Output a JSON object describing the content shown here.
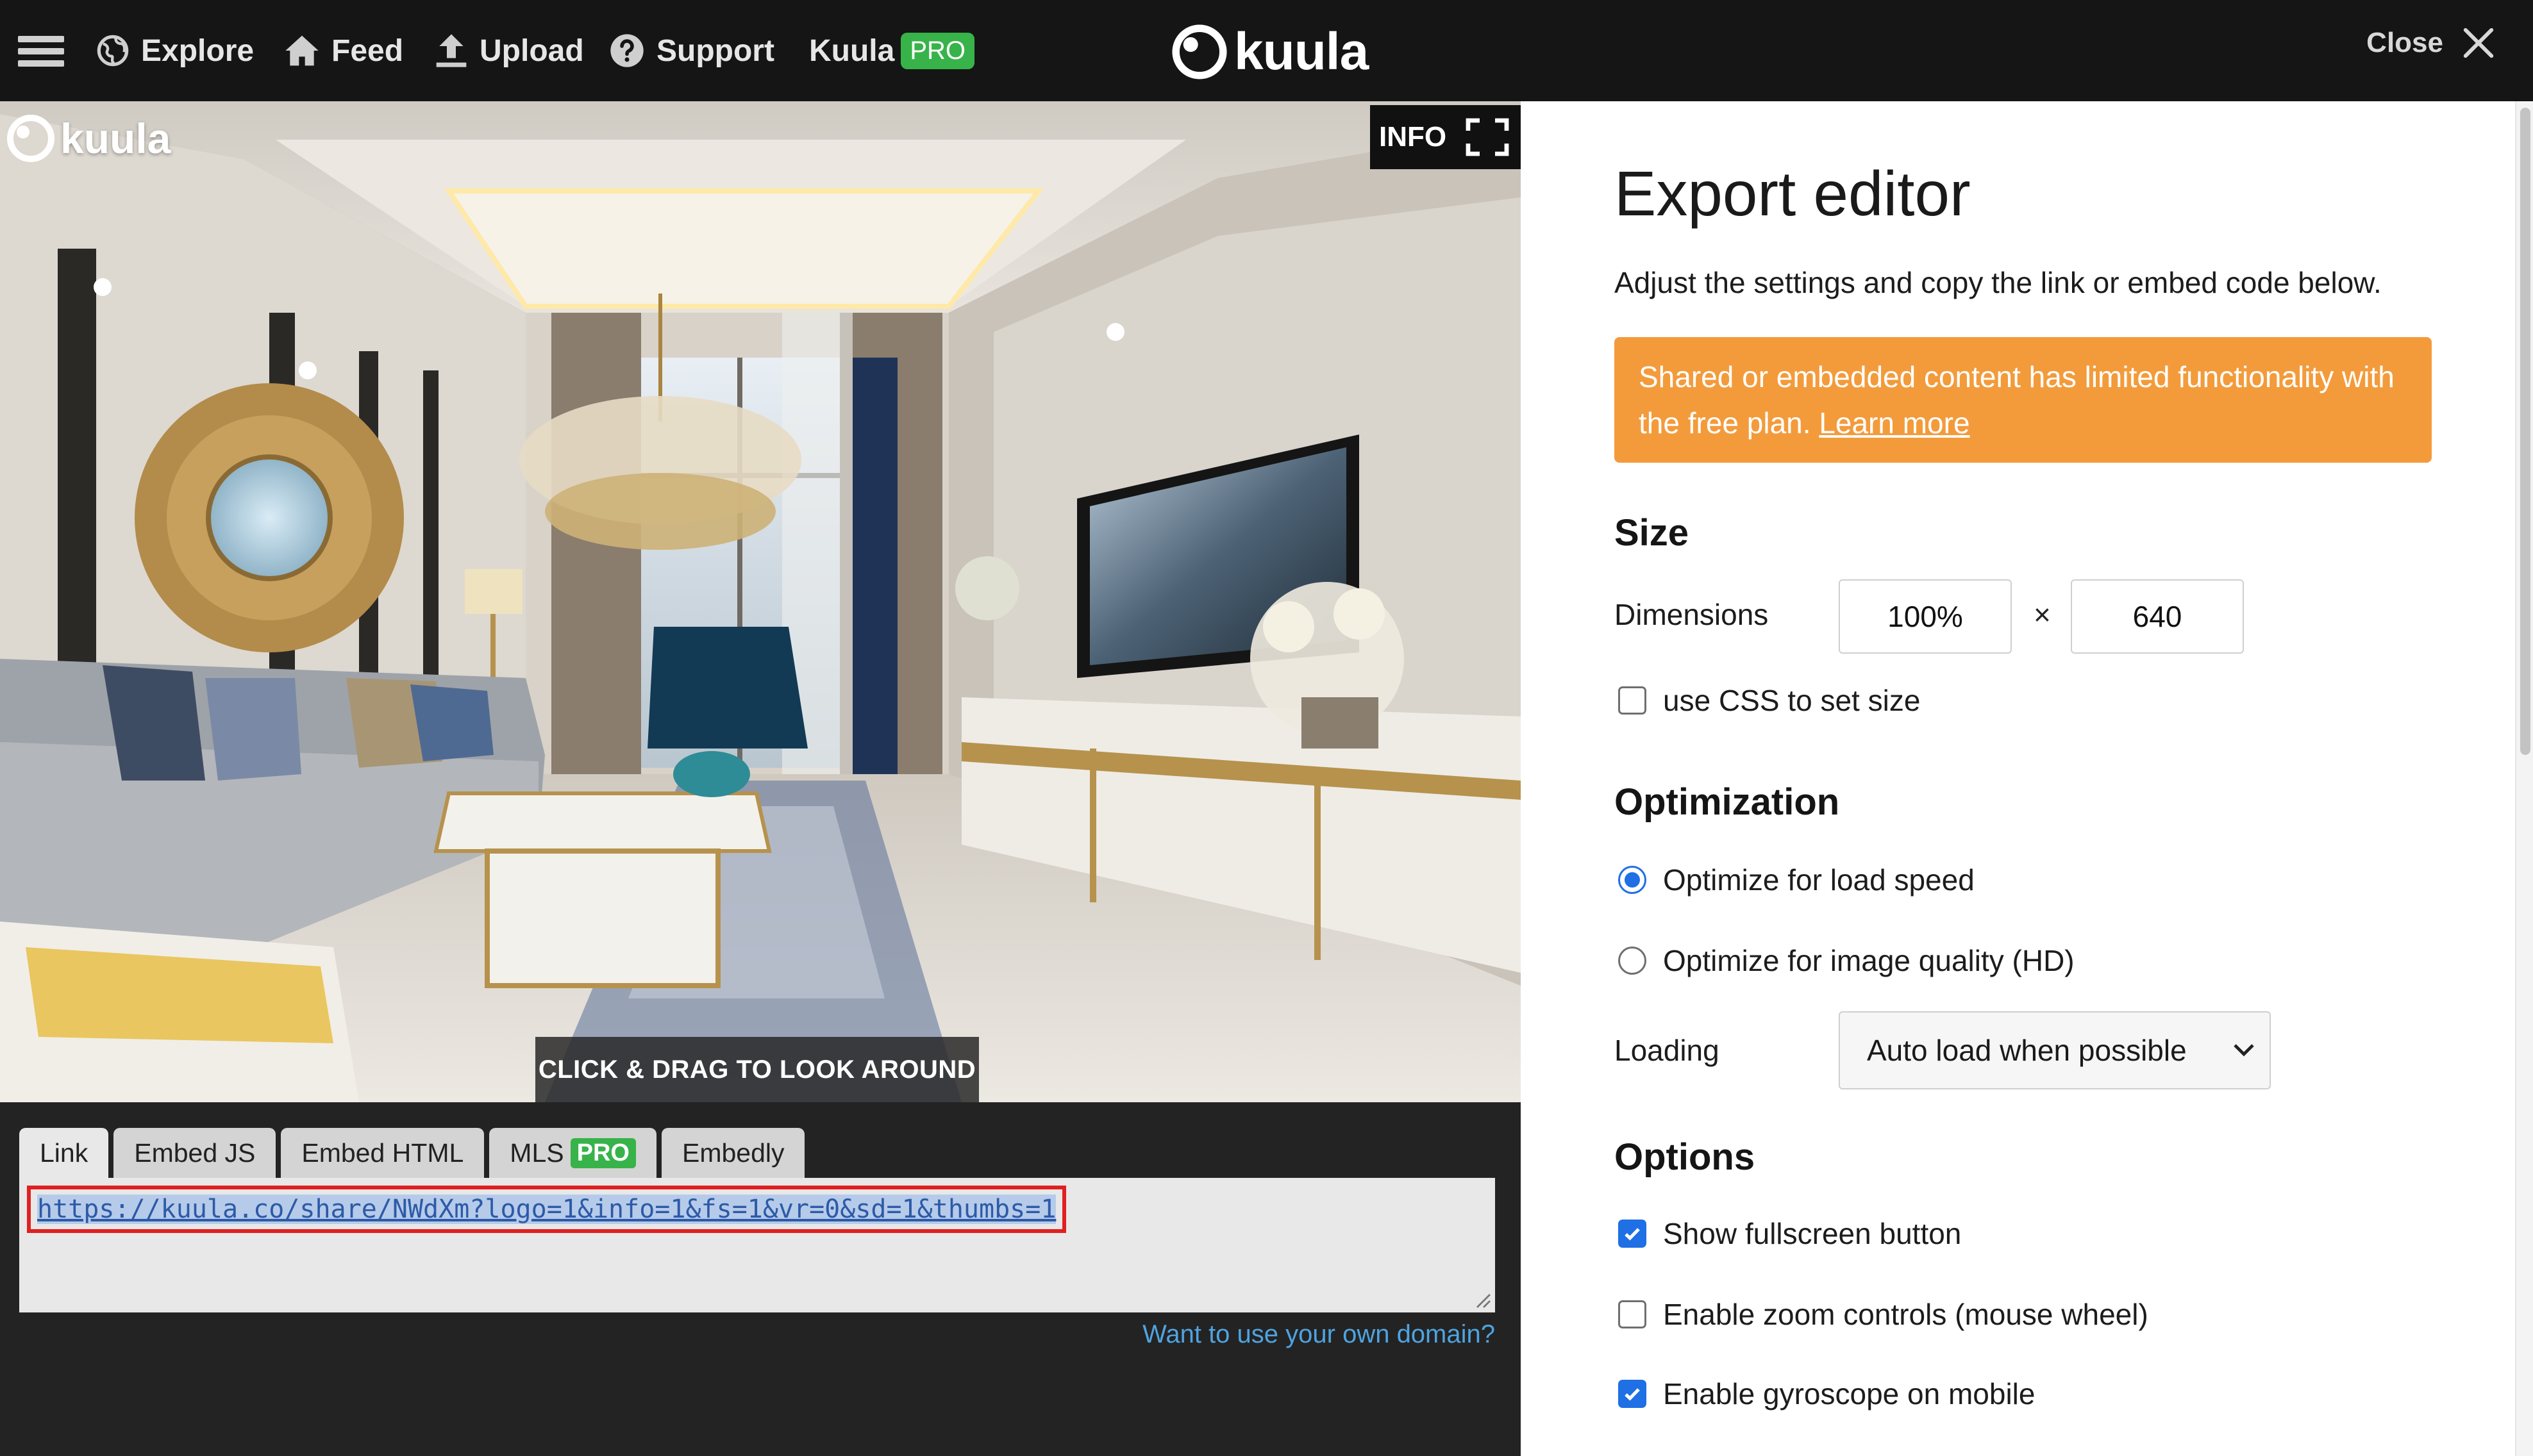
{
  "nav": {
    "items": [
      {
        "label": "Explore",
        "icon": "globe-icon"
      },
      {
        "label": "Feed",
        "icon": "home-icon"
      },
      {
        "label": "Upload",
        "icon": "upload-icon"
      },
      {
        "label": "Support",
        "icon": "question-icon"
      }
    ],
    "kuula_label": "Kuula",
    "pro_badge": "PRO",
    "brand": "kuula",
    "close_label": "Close"
  },
  "viewer": {
    "logo_text": "kuula",
    "info_label": "INFO",
    "drag_hint": "CLICK & DRAG TO LOOK AROUND"
  },
  "share": {
    "tabs": [
      {
        "label": "Link",
        "active": true
      },
      {
        "label": "Embed JS",
        "active": false
      },
      {
        "label": "Embed HTML",
        "active": false
      },
      {
        "label": "MLS",
        "badge": "PRO",
        "active": false
      },
      {
        "label": "Embedly",
        "active": false
      }
    ],
    "url": "https://kuula.co/share/NWdXm?logo=1&info=1&fs=1&vr=0&sd=1&thumbs=1",
    "domain_link": "Want to use your own domain?"
  },
  "editor": {
    "title": "Export editor",
    "subtitle": "Adjust the settings and copy the link or embed code below.",
    "alert_text": "Shared or embedded content has limited functionality with the free plan.",
    "alert_link": "Learn more",
    "size": {
      "heading": "Size",
      "dimensions_label": "Dimensions",
      "width": "100%",
      "times": "×",
      "height": "640",
      "css_option": {
        "label": "use CSS to set size",
        "checked": false
      }
    },
    "optimization": {
      "heading": "Optimization",
      "options": [
        {
          "label": "Optimize for load speed",
          "selected": true
        },
        {
          "label": "Optimize for image quality (HD)",
          "selected": false
        }
      ],
      "loading_label": "Loading",
      "loading_value": "Auto load when possible"
    },
    "options": {
      "heading": "Options",
      "items": [
        {
          "label": "Show fullscreen button",
          "checked": true
        },
        {
          "label": "Enable zoom controls (mouse wheel)",
          "checked": false
        },
        {
          "label": "Enable gyroscope on mobile",
          "checked": true
        }
      ]
    }
  },
  "colors": {
    "topbar_bg": "#151515",
    "pro_green": "#37b34a",
    "alert_orange": "#f39b3b",
    "accent_blue": "#1f6fe5",
    "link_blue": "#4fa3e0",
    "highlight_red": "#e02020"
  }
}
